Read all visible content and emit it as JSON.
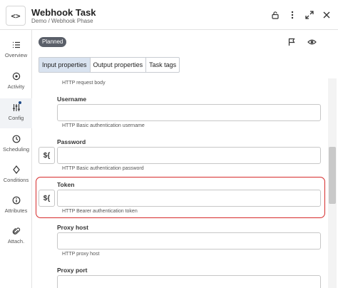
{
  "header": {
    "logo_glyph": "<>",
    "title": "Webhook Task",
    "breadcrumb": "Demo / Webhook Phase",
    "icons": [
      "lock-icon",
      "more-vertical-icon",
      "expand-icon",
      "close-icon"
    ]
  },
  "sidebar": {
    "items": [
      {
        "label": "Overview",
        "icon": "list-icon"
      },
      {
        "label": "Activity",
        "icon": "activity-icon"
      },
      {
        "label": "Config",
        "icon": "sliders-icon",
        "active": true,
        "has_dot": true
      },
      {
        "label": "Scheduling",
        "icon": "clock-icon"
      },
      {
        "label": "Conditions",
        "icon": "diamond-icon"
      },
      {
        "label": "Attributes",
        "icon": "info-icon"
      },
      {
        "label": "Attach.",
        "icon": "paperclip-icon"
      }
    ]
  },
  "status_badge": "Planned",
  "toolbar_icons": [
    "flag-icon",
    "eye-icon"
  ],
  "tabs": [
    {
      "label": "Input properties",
      "active": true
    },
    {
      "label": "Output properties",
      "active": false
    },
    {
      "label": "Task tags",
      "active": false
    }
  ],
  "form": {
    "top_help": "HTTP request body",
    "fields": [
      {
        "label": "Username",
        "value": "",
        "help": "HTTP Basic authentication username",
        "has_expression": false
      },
      {
        "label": "Password",
        "value": "",
        "help": "HTTP Basic authentication password",
        "has_expression": true
      },
      {
        "label": "Token",
        "value": "",
        "help": "HTTP Bearer authentication token",
        "has_expression": true,
        "highlighted": true
      },
      {
        "label": "Proxy host",
        "value": "",
        "help": "HTTP proxy host",
        "has_expression": false
      },
      {
        "label": "Proxy port",
        "value": "",
        "help": "",
        "has_expression": false
      }
    ],
    "expression_glyph": "${"
  },
  "colors": {
    "highlight": "#d62b2b",
    "active_tab": "#d9e3f0",
    "badge": "#5a5f69",
    "accent_dot": "#1f4a88"
  }
}
